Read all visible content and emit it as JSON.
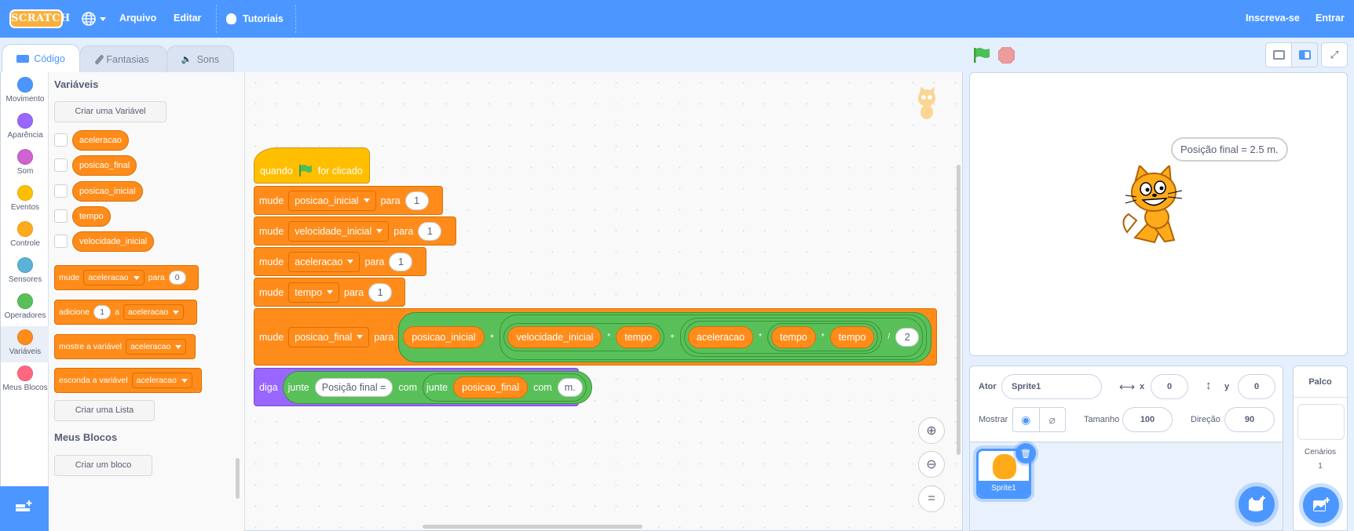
{
  "menubar": {
    "logo": "SCRATCH",
    "items": [
      "Arquivo",
      "Editar"
    ],
    "tutorials": "Tutoriais",
    "signup": "Inscreva-se",
    "signin": "Entrar"
  },
  "tabs": [
    {
      "label": "Código",
      "icon": "code-icon",
      "active": true
    },
    {
      "label": "Fantasias",
      "icon": "brush-icon",
      "active": false
    },
    {
      "label": "Sons",
      "icon": "speaker-icon",
      "active": false
    }
  ],
  "categories": [
    {
      "label": "Movimento",
      "color": "#4c97ff"
    },
    {
      "label": "Aparência",
      "color": "#9966ff"
    },
    {
      "label": "Som",
      "color": "#cf63cf"
    },
    {
      "label": "Eventos",
      "color": "#ffbf00"
    },
    {
      "label": "Controle",
      "color": "#ffab19"
    },
    {
      "label": "Sensores",
      "color": "#5cb1d6"
    },
    {
      "label": "Operadores",
      "color": "#59c059"
    },
    {
      "label": "Variáveis",
      "color": "#ff8c1a",
      "selected": true
    },
    {
      "label": "Meus Blocos",
      "color": "#ff6680"
    }
  ],
  "palette": {
    "variables_heading": "Variáveis",
    "create_variable": "Criar uma Variável",
    "variables": [
      "aceleracao",
      "posicao_final",
      "posicao_inicial",
      "tempo",
      "velocidade_inicial"
    ],
    "set_block": {
      "label": "mude",
      "var": "aceleracao",
      "to": "para",
      "value": "0"
    },
    "change_block": {
      "label": "adicione",
      "value": "1",
      "a": "a",
      "var": "aceleracao"
    },
    "show_block": {
      "label": "mostre a variável",
      "var": "aceleracao"
    },
    "hide_block": {
      "label": "esconda a variável",
      "var": "aceleracao"
    },
    "create_list": "Criar uma Lista",
    "myblocks_heading": "Meus Blocos",
    "create_block": "Criar um bloco"
  },
  "script": {
    "hat": {
      "when": "quando",
      "clicked": "for clicado"
    },
    "sets": [
      {
        "label": "mude",
        "var": "posicao_inicial",
        "to": "para",
        "value": "1"
      },
      {
        "label": "mude",
        "var": "velocidade_inicial",
        "to": "para",
        "value": "1"
      },
      {
        "label": "mude",
        "var": "aceleracao",
        "to": "para",
        "value": "1"
      },
      {
        "label": "mude",
        "var": "tempo",
        "to": "para",
        "value": "1"
      }
    ],
    "formula": {
      "label": "mude",
      "var": "posicao_final",
      "to": "para",
      "t1": "posicao_inicial",
      "plus1": "+",
      "t2a": "velocidade_inicial",
      "mul1": "*",
      "t2b": "tempo",
      "plus2": "+",
      "t3a": "aceleracao",
      "mul2": "*",
      "t3b": "tempo",
      "mul3": "*",
      "t3c": "tempo",
      "div": "/",
      "divisor": "2"
    },
    "say": {
      "label": "diga",
      "join1": "junte",
      "text1": "Posição final =",
      "with1": "com",
      "join2": "junte",
      "var": "posicao_final",
      "with2": "com",
      "text2": "m."
    }
  },
  "stage": {
    "speech": "Posição final = 2.5 m."
  },
  "sprite": {
    "actor_label": "Ator",
    "name": "Sprite1",
    "x_label": "x",
    "x": "0",
    "y_label": "y",
    "y": "0",
    "show_label": "Mostrar",
    "size_label": "Tamanho",
    "size": "100",
    "direction_label": "Direção",
    "direction": "90",
    "thumb_name": "Sprite1"
  },
  "stagepane": {
    "title": "Palco",
    "backdrops_label": "Cenários",
    "backdrops": "1"
  }
}
